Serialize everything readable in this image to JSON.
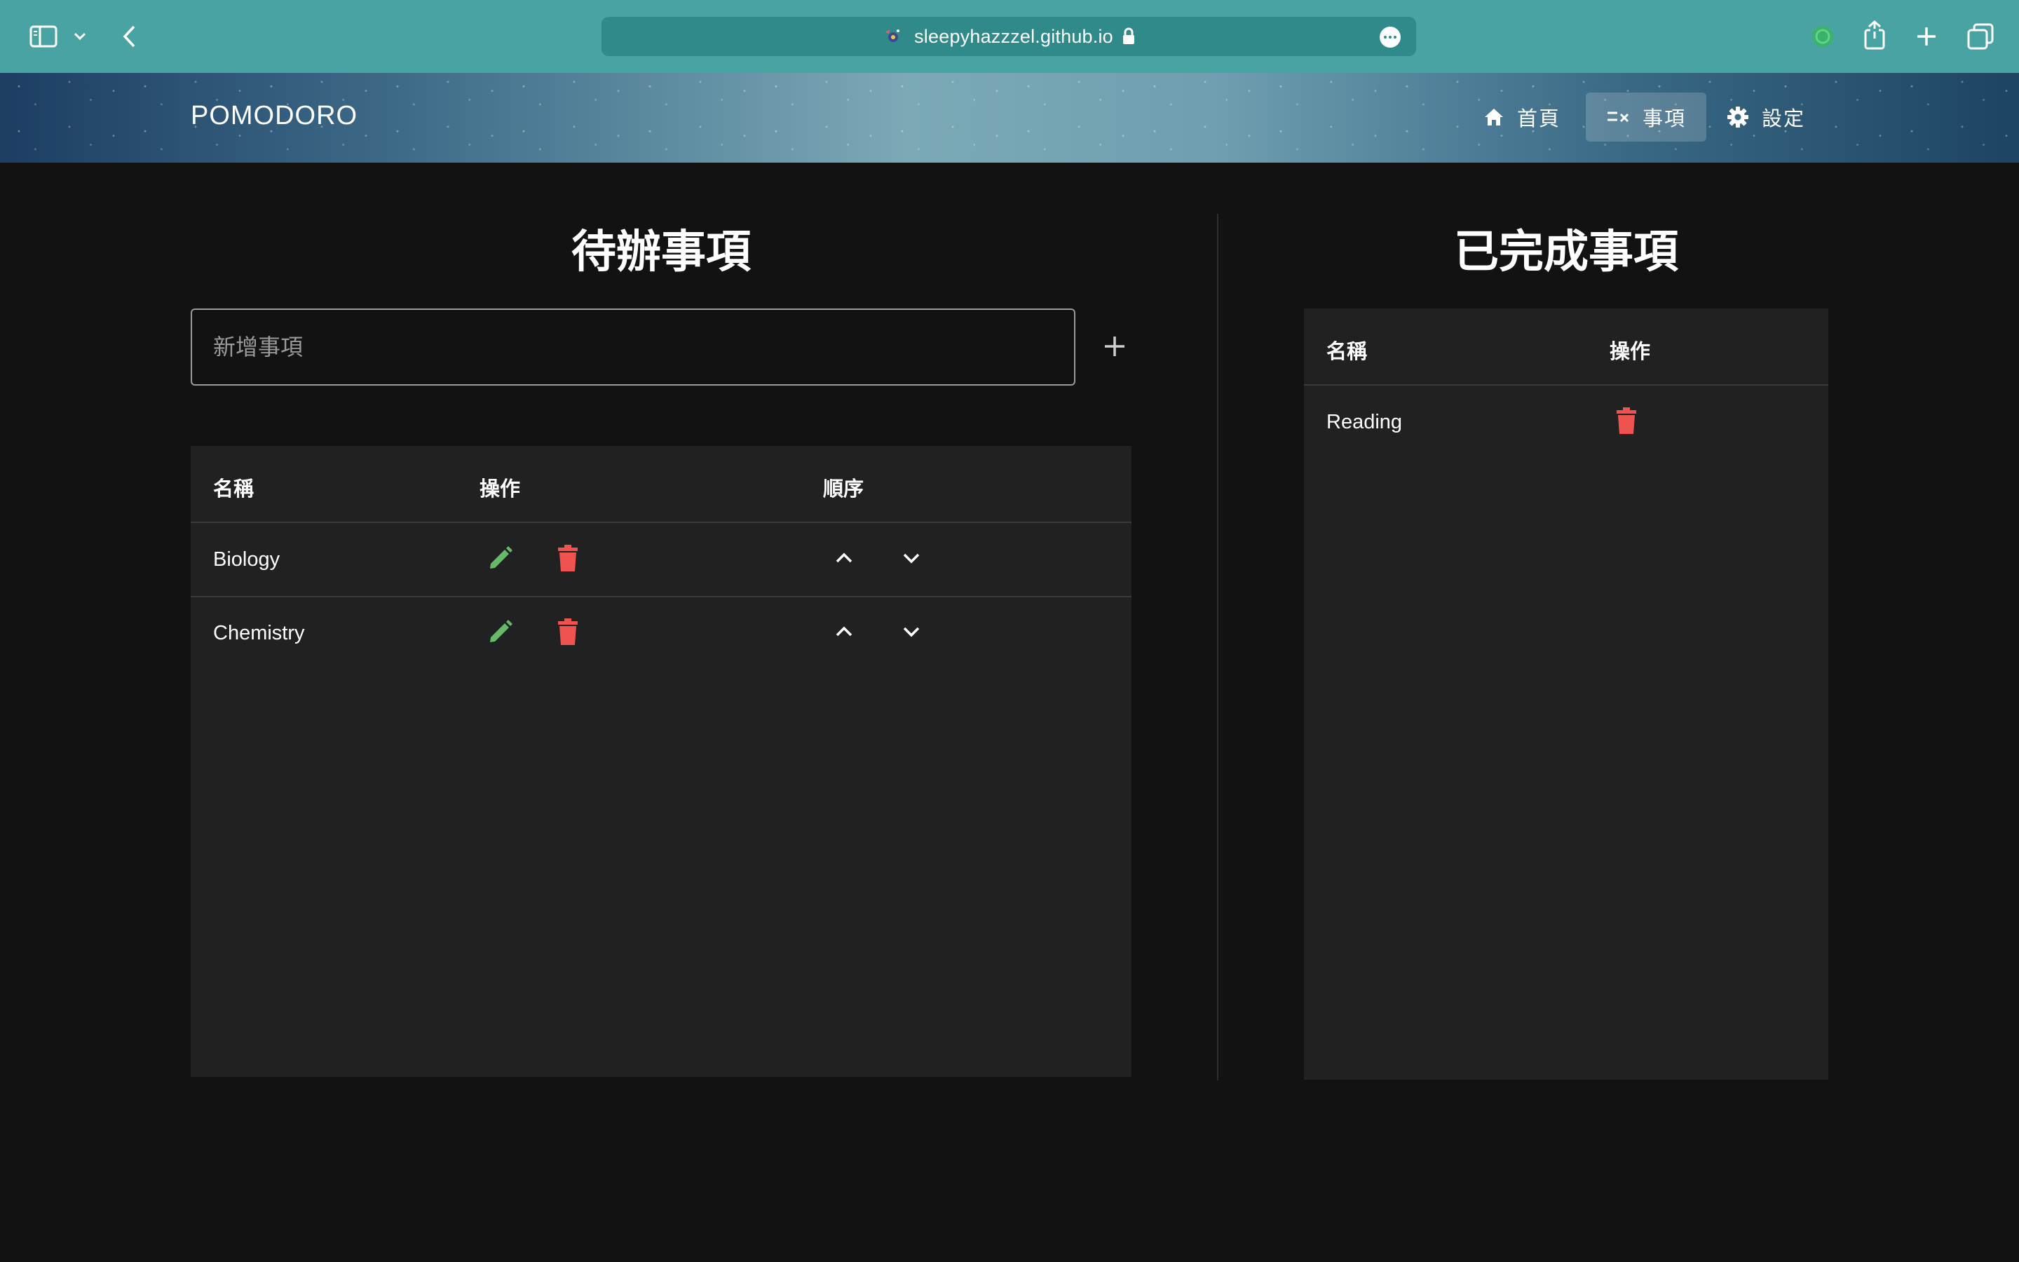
{
  "browser": {
    "url": "sleepyhazzzel.github.io"
  },
  "app": {
    "title": "POMODORO",
    "nav": [
      {
        "label": "首頁",
        "icon": "home-icon"
      },
      {
        "label": "事項",
        "icon": "checklist-icon",
        "active": true
      },
      {
        "label": "設定",
        "icon": "gear-icon"
      }
    ]
  },
  "todo": {
    "title": "待辦事項",
    "input_placeholder": "新增事項",
    "columns": [
      "名稱",
      "操作",
      "順序"
    ],
    "rows": [
      {
        "name": "Biology"
      },
      {
        "name": "Chemistry"
      }
    ]
  },
  "done": {
    "title": "已完成事項",
    "columns": [
      "名稱",
      "操作"
    ],
    "rows": [
      {
        "name": "Reading"
      }
    ]
  },
  "colors": {
    "edit": "#66bb6a",
    "delete": "#ef5350",
    "chrome": "#4aa3a3"
  }
}
